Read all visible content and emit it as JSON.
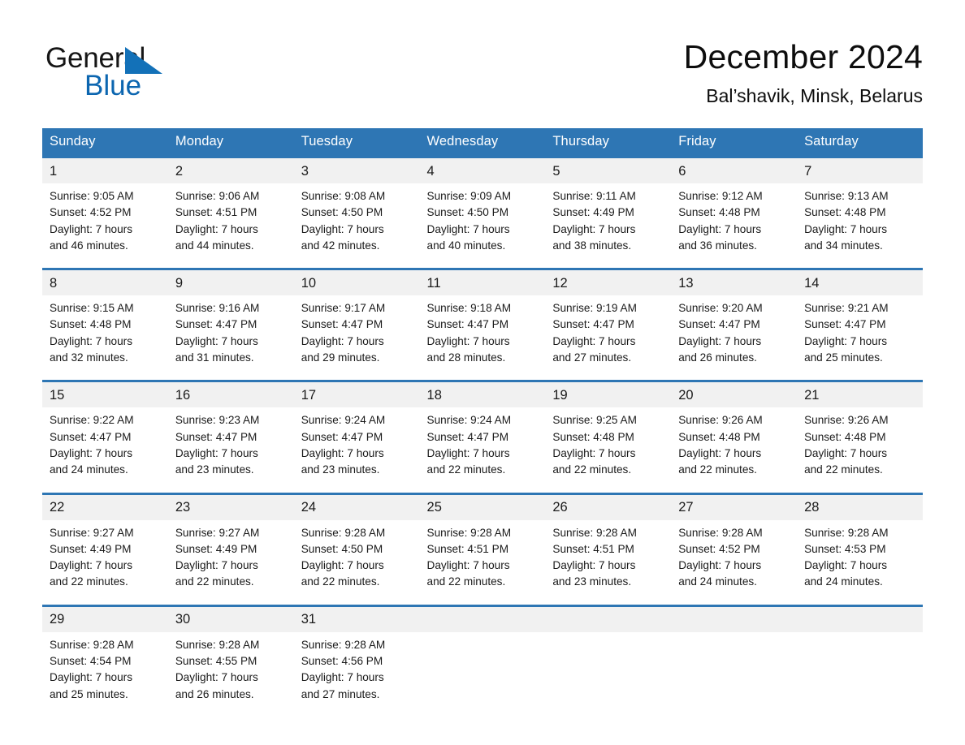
{
  "brand": {
    "name_part1": "General",
    "name_part2": "Blue",
    "triangle_color": "#1371b8",
    "accent_color": "#2e76b4"
  },
  "header": {
    "title": "December 2024",
    "subtitle": "Bal’shavik, Minsk, Belarus"
  },
  "weekday_headers": [
    "Sunday",
    "Monday",
    "Tuesday",
    "Wednesday",
    "Thursday",
    "Friday",
    "Saturday"
  ],
  "weeks": [
    {
      "days": [
        {
          "day": "1",
          "sunrise": "Sunrise: 9:05 AM",
          "sunset": "Sunset: 4:52 PM",
          "daylight_line1": "Daylight: 7 hours",
          "daylight_line2": "and 46 minutes."
        },
        {
          "day": "2",
          "sunrise": "Sunrise: 9:06 AM",
          "sunset": "Sunset: 4:51 PM",
          "daylight_line1": "Daylight: 7 hours",
          "daylight_line2": "and 44 minutes."
        },
        {
          "day": "3",
          "sunrise": "Sunrise: 9:08 AM",
          "sunset": "Sunset: 4:50 PM",
          "daylight_line1": "Daylight: 7 hours",
          "daylight_line2": "and 42 minutes."
        },
        {
          "day": "4",
          "sunrise": "Sunrise: 9:09 AM",
          "sunset": "Sunset: 4:50 PM",
          "daylight_line1": "Daylight: 7 hours",
          "daylight_line2": "and 40 minutes."
        },
        {
          "day": "5",
          "sunrise": "Sunrise: 9:11 AM",
          "sunset": "Sunset: 4:49 PM",
          "daylight_line1": "Daylight: 7 hours",
          "daylight_line2": "and 38 minutes."
        },
        {
          "day": "6",
          "sunrise": "Sunrise: 9:12 AM",
          "sunset": "Sunset: 4:48 PM",
          "daylight_line1": "Daylight: 7 hours",
          "daylight_line2": "and 36 minutes."
        },
        {
          "day": "7",
          "sunrise": "Sunrise: 9:13 AM",
          "sunset": "Sunset: 4:48 PM",
          "daylight_line1": "Daylight: 7 hours",
          "daylight_line2": "and 34 minutes."
        }
      ]
    },
    {
      "days": [
        {
          "day": "8",
          "sunrise": "Sunrise: 9:15 AM",
          "sunset": "Sunset: 4:48 PM",
          "daylight_line1": "Daylight: 7 hours",
          "daylight_line2": "and 32 minutes."
        },
        {
          "day": "9",
          "sunrise": "Sunrise: 9:16 AM",
          "sunset": "Sunset: 4:47 PM",
          "daylight_line1": "Daylight: 7 hours",
          "daylight_line2": "and 31 minutes."
        },
        {
          "day": "10",
          "sunrise": "Sunrise: 9:17 AM",
          "sunset": "Sunset: 4:47 PM",
          "daylight_line1": "Daylight: 7 hours",
          "daylight_line2": "and 29 minutes."
        },
        {
          "day": "11",
          "sunrise": "Sunrise: 9:18 AM",
          "sunset": "Sunset: 4:47 PM",
          "daylight_line1": "Daylight: 7 hours",
          "daylight_line2": "and 28 minutes."
        },
        {
          "day": "12",
          "sunrise": "Sunrise: 9:19 AM",
          "sunset": "Sunset: 4:47 PM",
          "daylight_line1": "Daylight: 7 hours",
          "daylight_line2": "and 27 minutes."
        },
        {
          "day": "13",
          "sunrise": "Sunrise: 9:20 AM",
          "sunset": "Sunset: 4:47 PM",
          "daylight_line1": "Daylight: 7 hours",
          "daylight_line2": "and 26 minutes."
        },
        {
          "day": "14",
          "sunrise": "Sunrise: 9:21 AM",
          "sunset": "Sunset: 4:47 PM",
          "daylight_line1": "Daylight: 7 hours",
          "daylight_line2": "and 25 minutes."
        }
      ]
    },
    {
      "days": [
        {
          "day": "15",
          "sunrise": "Sunrise: 9:22 AM",
          "sunset": "Sunset: 4:47 PM",
          "daylight_line1": "Daylight: 7 hours",
          "daylight_line2": "and 24 minutes."
        },
        {
          "day": "16",
          "sunrise": "Sunrise: 9:23 AM",
          "sunset": "Sunset: 4:47 PM",
          "daylight_line1": "Daylight: 7 hours",
          "daylight_line2": "and 23 minutes."
        },
        {
          "day": "17",
          "sunrise": "Sunrise: 9:24 AM",
          "sunset": "Sunset: 4:47 PM",
          "daylight_line1": "Daylight: 7 hours",
          "daylight_line2": "and 23 minutes."
        },
        {
          "day": "18",
          "sunrise": "Sunrise: 9:24 AM",
          "sunset": "Sunset: 4:47 PM",
          "daylight_line1": "Daylight: 7 hours",
          "daylight_line2": "and 22 minutes."
        },
        {
          "day": "19",
          "sunrise": "Sunrise: 9:25 AM",
          "sunset": "Sunset: 4:48 PM",
          "daylight_line1": "Daylight: 7 hours",
          "daylight_line2": "and 22 minutes."
        },
        {
          "day": "20",
          "sunrise": "Sunrise: 9:26 AM",
          "sunset": "Sunset: 4:48 PM",
          "daylight_line1": "Daylight: 7 hours",
          "daylight_line2": "and 22 minutes."
        },
        {
          "day": "21",
          "sunrise": "Sunrise: 9:26 AM",
          "sunset": "Sunset: 4:48 PM",
          "daylight_line1": "Daylight: 7 hours",
          "daylight_line2": "and 22 minutes."
        }
      ]
    },
    {
      "days": [
        {
          "day": "22",
          "sunrise": "Sunrise: 9:27 AM",
          "sunset": "Sunset: 4:49 PM",
          "daylight_line1": "Daylight: 7 hours",
          "daylight_line2": "and 22 minutes."
        },
        {
          "day": "23",
          "sunrise": "Sunrise: 9:27 AM",
          "sunset": "Sunset: 4:49 PM",
          "daylight_line1": "Daylight: 7 hours",
          "daylight_line2": "and 22 minutes."
        },
        {
          "day": "24",
          "sunrise": "Sunrise: 9:28 AM",
          "sunset": "Sunset: 4:50 PM",
          "daylight_line1": "Daylight: 7 hours",
          "daylight_line2": "and 22 minutes."
        },
        {
          "day": "25",
          "sunrise": "Sunrise: 9:28 AM",
          "sunset": "Sunset: 4:51 PM",
          "daylight_line1": "Daylight: 7 hours",
          "daylight_line2": "and 22 minutes."
        },
        {
          "day": "26",
          "sunrise": "Sunrise: 9:28 AM",
          "sunset": "Sunset: 4:51 PM",
          "daylight_line1": "Daylight: 7 hours",
          "daylight_line2": "and 23 minutes."
        },
        {
          "day": "27",
          "sunrise": "Sunrise: 9:28 AM",
          "sunset": "Sunset: 4:52 PM",
          "daylight_line1": "Daylight: 7 hours",
          "daylight_line2": "and 24 minutes."
        },
        {
          "day": "28",
          "sunrise": "Sunrise: 9:28 AM",
          "sunset": "Sunset: 4:53 PM",
          "daylight_line1": "Daylight: 7 hours",
          "daylight_line2": "and 24 minutes."
        }
      ]
    },
    {
      "days": [
        {
          "day": "29",
          "sunrise": "Sunrise: 9:28 AM",
          "sunset": "Sunset: 4:54 PM",
          "daylight_line1": "Daylight: 7 hours",
          "daylight_line2": "and 25 minutes."
        },
        {
          "day": "30",
          "sunrise": "Sunrise: 9:28 AM",
          "sunset": "Sunset: 4:55 PM",
          "daylight_line1": "Daylight: 7 hours",
          "daylight_line2": "and 26 minutes."
        },
        {
          "day": "31",
          "sunrise": "Sunrise: 9:28 AM",
          "sunset": "Sunset: 4:56 PM",
          "daylight_line1": "Daylight: 7 hours",
          "daylight_line2": "and 27 minutes."
        },
        {
          "day": "",
          "sunrise": "",
          "sunset": "",
          "daylight_line1": "",
          "daylight_line2": ""
        },
        {
          "day": "",
          "sunrise": "",
          "sunset": "",
          "daylight_line1": "",
          "daylight_line2": ""
        },
        {
          "day": "",
          "sunrise": "",
          "sunset": "",
          "daylight_line1": "",
          "daylight_line2": ""
        },
        {
          "day": "",
          "sunrise": "",
          "sunset": "",
          "daylight_line1": "",
          "daylight_line2": ""
        }
      ]
    }
  ]
}
